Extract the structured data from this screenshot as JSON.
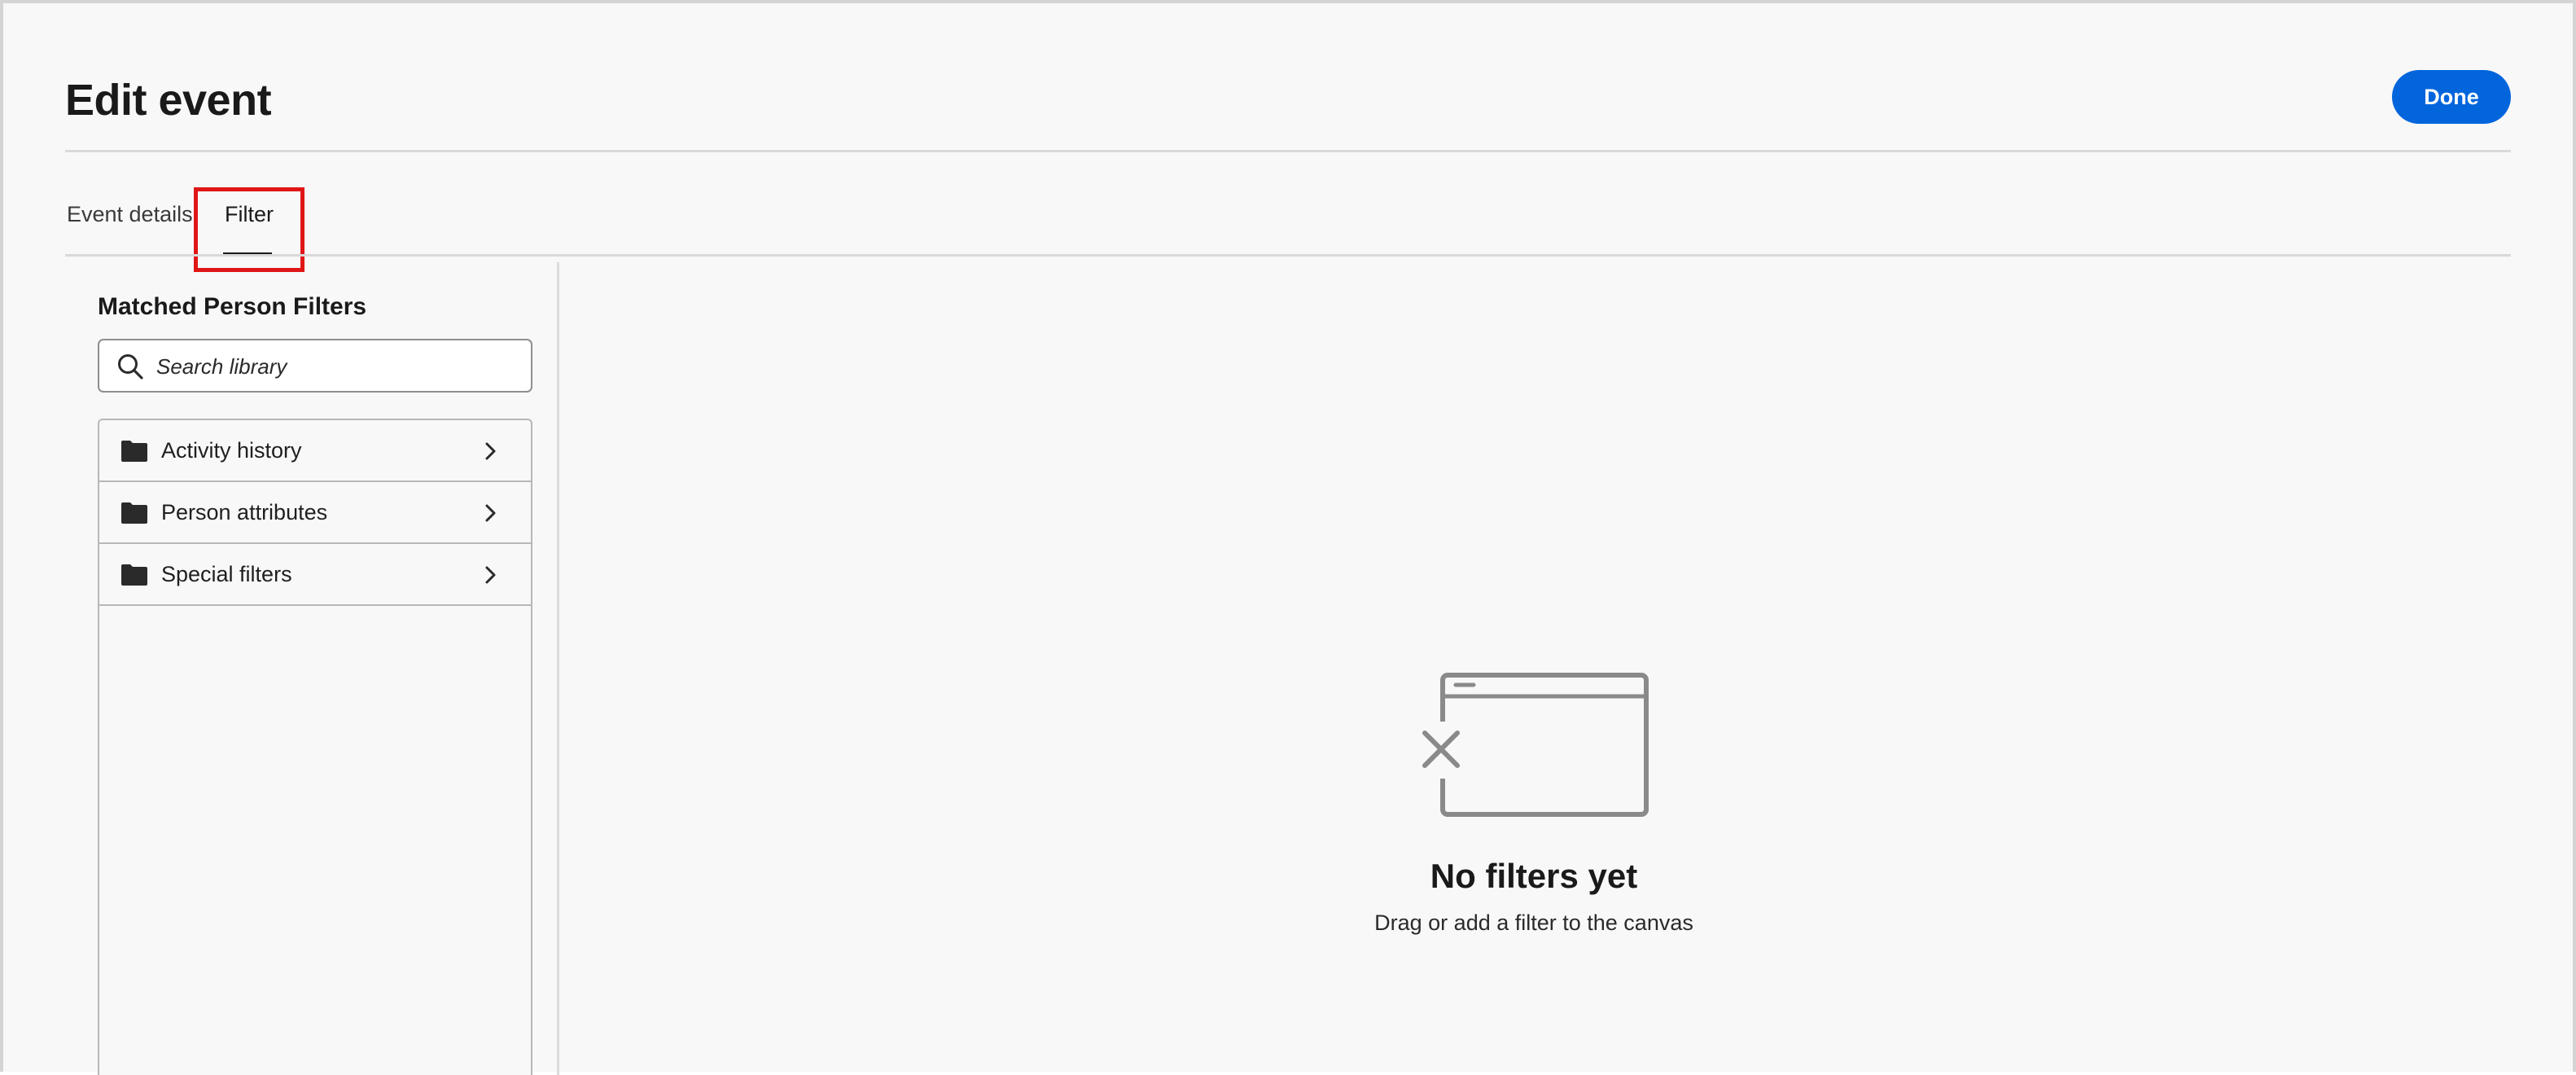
{
  "dialog": {
    "title": "Edit event",
    "done_label": "Done"
  },
  "tabs": [
    {
      "label": "Event details",
      "selected": false
    },
    {
      "label": "Filter",
      "selected": true
    }
  ],
  "left_panel": {
    "heading": "Matched Person Filters",
    "search": {
      "placeholder": "Search library",
      "value": ""
    },
    "items": [
      {
        "label": "Activity history",
        "icon": "folder-icon"
      },
      {
        "label": "Person attributes",
        "icon": "folder-icon"
      },
      {
        "label": "Special filters",
        "icon": "folder-icon"
      }
    ]
  },
  "canvas": {
    "empty_title": "No filters yet",
    "empty_subtitle": "Drag or add a filter to the canvas",
    "icon": "empty-window-icon"
  },
  "colors": {
    "accent": "#0265dc",
    "highlight": "#e01616",
    "background": "#f8f8f8"
  }
}
